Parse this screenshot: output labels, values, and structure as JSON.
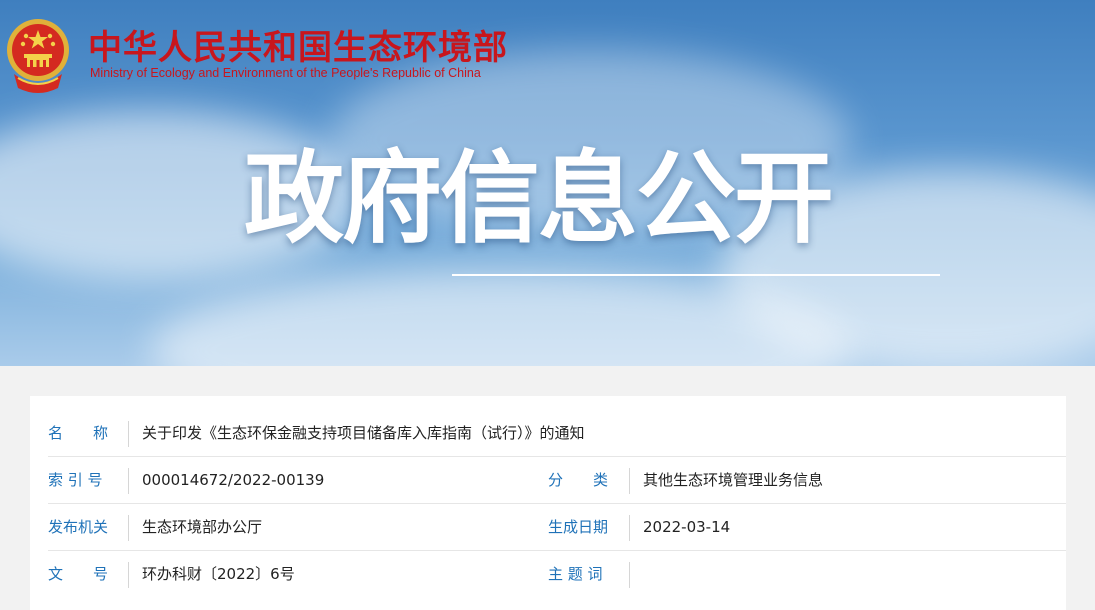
{
  "header": {
    "ministry_name_cn": "中华人民共和国生态环境部",
    "ministry_name_en": "Ministry of Ecology and Environment of the People's Republic of China",
    "page_heading": "政府信息公开",
    "emblem_icon": "national-emblem-icon"
  },
  "colors": {
    "ministry_red": "#c8161d",
    "label_blue": "#1f72b8",
    "banner_blue": "#4a89c8"
  },
  "info_table": {
    "rows": [
      {
        "label": "名　　称",
        "value": "关于印发《生态环保金融支持项目储备库入库指南（试行）》的通知"
      },
      {
        "label": "索 引 号",
        "value": "000014672/2022-00139",
        "label2": "分　　类",
        "value2": "其他生态环境管理业务信息"
      },
      {
        "label": "发布机关",
        "value": "生态环境部办公厅",
        "label2": "生成日期",
        "value2": "2022-03-14"
      },
      {
        "label": "文　　号",
        "value": "环办科财〔2022〕6号",
        "label2": "主 题 词",
        "value2": ""
      }
    ]
  }
}
